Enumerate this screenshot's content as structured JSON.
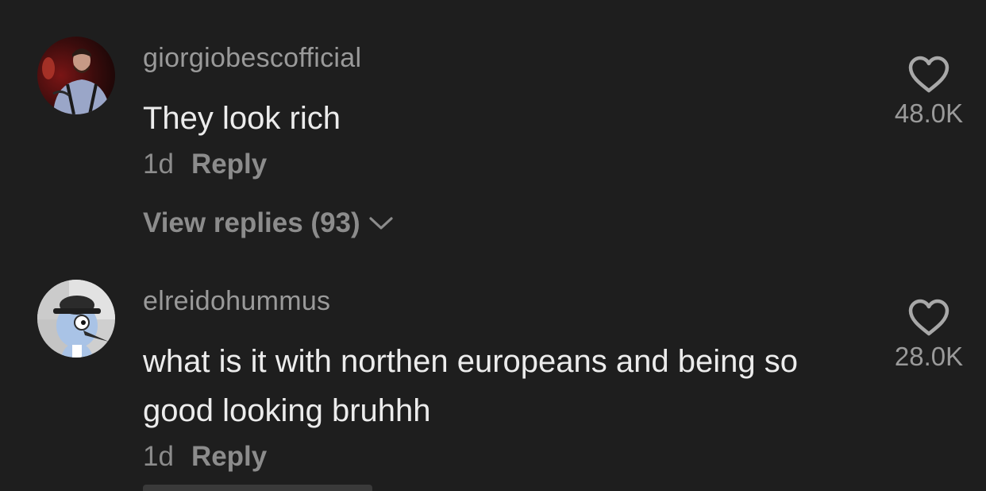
{
  "comments": [
    {
      "username": "giorgiobescofficial",
      "text": "They look rich",
      "time": "1d",
      "reply_label": "Reply",
      "view_replies": "View replies (93)",
      "likes": "48.0K",
      "avatar_icon": "photo-avatar"
    },
    {
      "username": "elreidohummus",
      "text": "what is it with northen europeans and being so good looking bruhhh",
      "time": "1d",
      "reply_label": "Reply",
      "likes": "28.0K",
      "avatar_icon": "cartoon-avatar"
    }
  ],
  "colors": {
    "background": "#1e1e1e",
    "username": "#9a9a9a",
    "text": "#ececec",
    "meta": "#8c8c8c"
  }
}
